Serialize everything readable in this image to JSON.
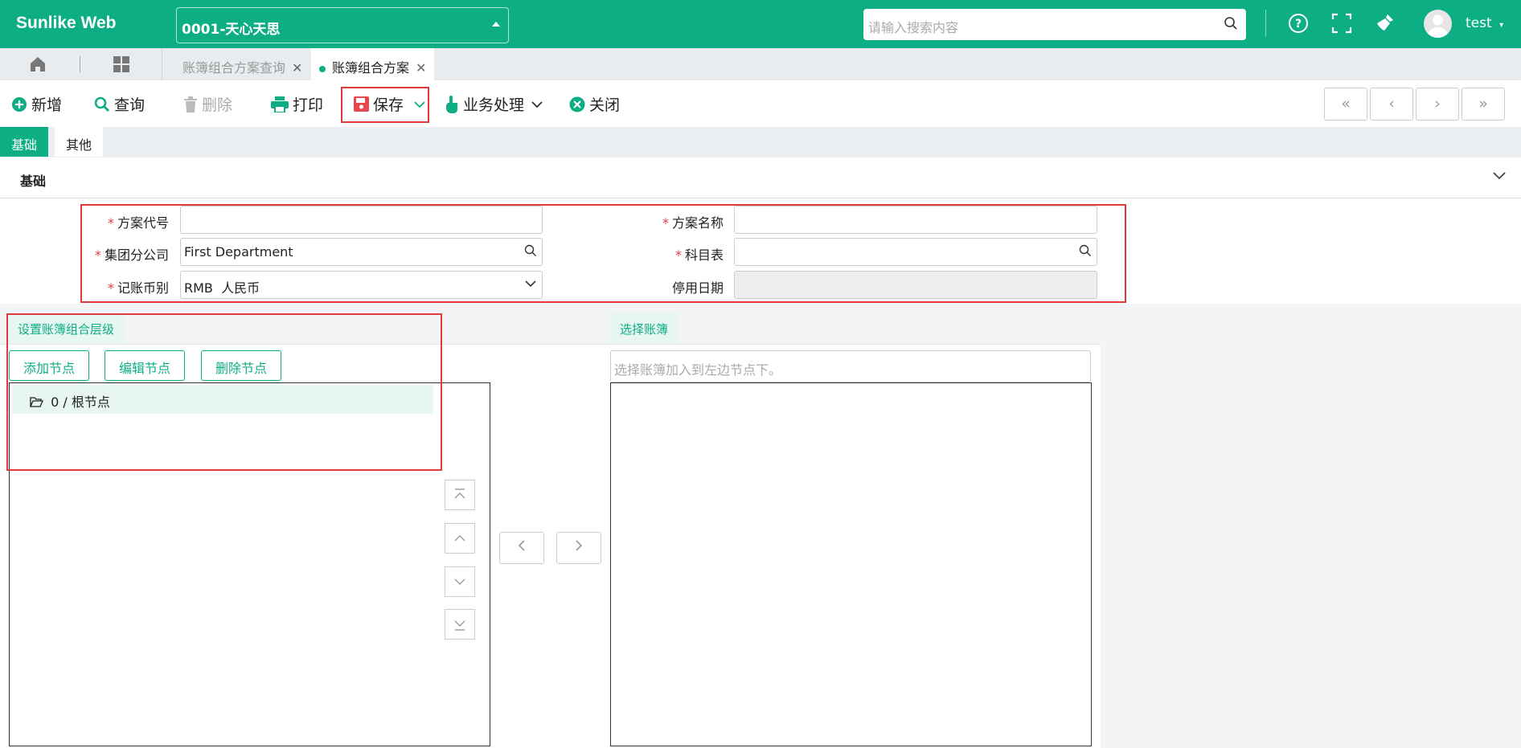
{
  "header": {
    "brand": "Sunlike Web",
    "company": "0001-天心天思",
    "search_placeholder": "请输入搜索内容",
    "user": "test",
    "colors": {
      "brand": "#0eae84",
      "highlight": "#e03b3b"
    }
  },
  "tabs": [
    {
      "label": "账簿组合方案查询"
    },
    {
      "label": "账簿组合方案"
    }
  ],
  "toolbar": {
    "add": "新增",
    "query": "查询",
    "delete": "删除",
    "print": "打印",
    "save": "保存",
    "business": "业务处理",
    "close": "关闭"
  },
  "subtabs": {
    "basic": "基础",
    "other": "其他"
  },
  "section": {
    "title": "基础"
  },
  "form": {
    "scheme_code": {
      "label": "方案代号",
      "value": ""
    },
    "scheme_name": {
      "label": "方案名称",
      "value": ""
    },
    "branch": {
      "label": "集团分公司",
      "value": "First Department"
    },
    "account_table": {
      "label": "科目表",
      "value": ""
    },
    "currency": {
      "label": "记账币别",
      "value": "RMB  人民币"
    },
    "disable_date": {
      "label": "停用日期",
      "value": ""
    }
  },
  "left_panel": {
    "title": "设置账簿组合层级",
    "add_node": "添加节点",
    "edit_node": "编辑节点",
    "delete_node": "删除节点",
    "root_node": "0 / 根节点"
  },
  "right_panel": {
    "title": "选择账簿",
    "placeholder": "选择账簿加入到左边节点下。"
  }
}
